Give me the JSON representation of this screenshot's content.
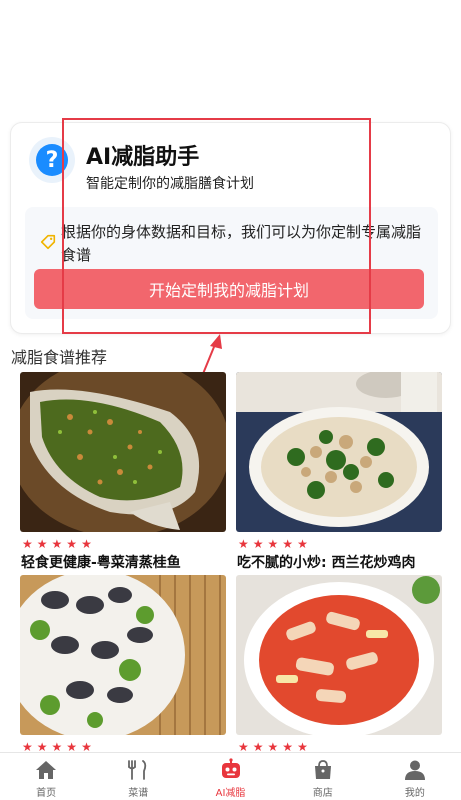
{
  "assistant": {
    "title": "AI减脂助手",
    "subtitle": "智能定制你的减脂膳食计划",
    "description": "根据你的身体数据和目标，我们可以为你定制专属减脂食谱",
    "button_label": "开始定制我的减脂计划"
  },
  "section": {
    "title": "减脂食谱推荐"
  },
  "recipes": [
    {
      "name": "轻食更健康-粤菜清蒸桂鱼",
      "rating": 5
    },
    {
      "name": "吃不腻的小炒: 西兰花炒鸡肉",
      "rating": 5
    },
    {
      "name": "",
      "rating": 5
    },
    {
      "name": "",
      "rating": 5
    }
  ],
  "tabbar": {
    "items": [
      {
        "label": "首页",
        "icon": "home-icon"
      },
      {
        "label": "菜谱",
        "icon": "utensils-icon"
      },
      {
        "label": "AI减脂",
        "icon": "robot-icon",
        "active": true
      },
      {
        "label": "商店",
        "icon": "shop-bag-icon"
      },
      {
        "label": "我的",
        "icon": "user-icon"
      }
    ]
  },
  "colors": {
    "accent": "#f2666d",
    "active_tab": "#e8363d",
    "annotation": "#e53b47",
    "help_blue": "#1a8cff"
  }
}
